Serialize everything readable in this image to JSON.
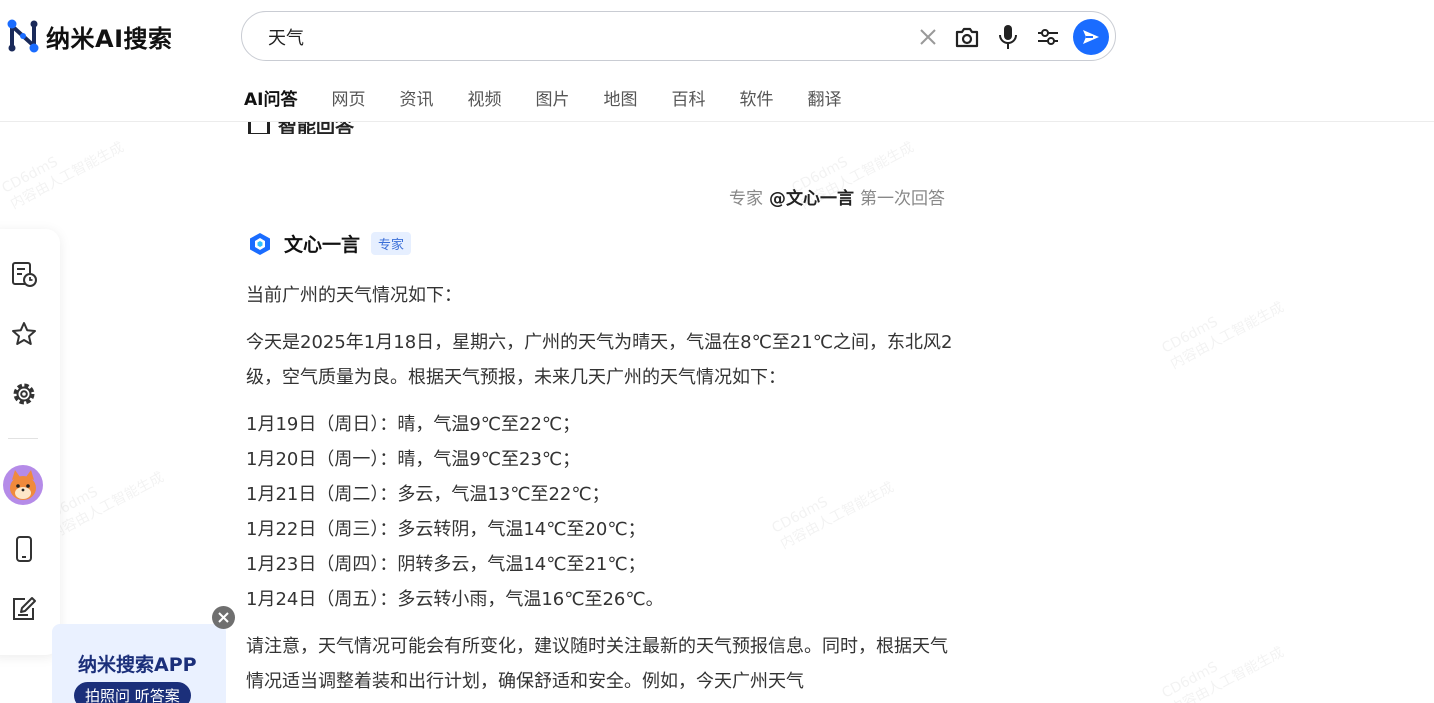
{
  "brand": {
    "name": "纳米AI搜索",
    "accent": "#1a6cff"
  },
  "search": {
    "query": "天气"
  },
  "tabs": [
    {
      "label": "AI问答",
      "active": true
    },
    {
      "label": "网页"
    },
    {
      "label": "资讯"
    },
    {
      "label": "视频"
    },
    {
      "label": "图片"
    },
    {
      "label": "地图"
    },
    {
      "label": "百科"
    },
    {
      "label": "软件"
    },
    {
      "label": "翻译"
    }
  ],
  "section": {
    "heading": "智能回答"
  },
  "expert": {
    "prefix": "专家",
    "handle": "@文心一言",
    "suffix": "第一次回答"
  },
  "source": {
    "name": "文心一言",
    "badge": "专家"
  },
  "answer": {
    "intro": "当前广州的天气情况如下：",
    "today": "今天是2025年1月18日，星期六，广州的天气为晴天，气温在8℃至21℃之间，东北风2级，空气质量为良。根据天气预报，未来几天广州的天气情况如下：",
    "forecast": [
      "1月19日（周日）：晴，气温9℃至22℃；",
      "1月20日（周一）：晴，气温9℃至23℃；",
      "1月21日（周二）：多云，气温13℃至22℃；",
      "1月22日（周三）：多云转阴，气温14℃至20℃；",
      "1月23日（周四）：阴转多云，气温14℃至21℃；",
      "1月24日（周五）：多云转小雨，气温16℃至26℃。"
    ],
    "note": "请注意，天气情况可能会有所变化，建议随时关注最新的天气预报信息。同时，根据天气情况适当调整着装和出行计划，确保舒适和安全。例如，今天广州天气"
  },
  "sidebar_icons": [
    "history-icon",
    "star-icon",
    "gear-icon",
    "avatar",
    "phone-icon",
    "edit-icon"
  ],
  "promo": {
    "title": "纳米搜索APP",
    "subtitle": "拍照问 听答案"
  },
  "watermark": {
    "line1": "CD6dmS",
    "line2": "内容由人工智能生成"
  }
}
